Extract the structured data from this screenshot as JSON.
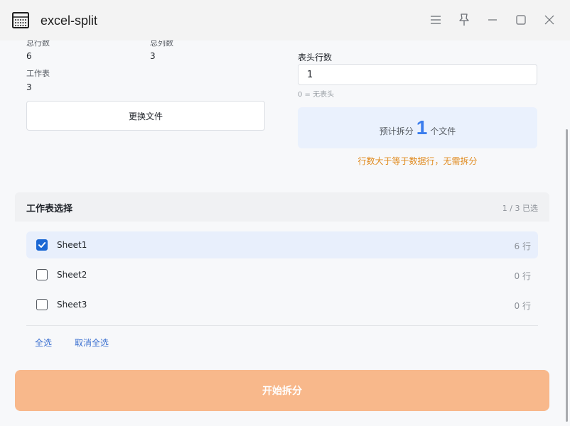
{
  "window": {
    "title": "excel-split",
    "icons": [
      "menu-icon",
      "pin-icon",
      "minimize-icon",
      "maximize-icon",
      "close-icon"
    ]
  },
  "summary": {
    "total_rows_label": "总行数",
    "total_rows_value": "6",
    "total_cols_label": "总列数",
    "total_cols_value": "3",
    "sheets_label": "工作表",
    "sheets_value": "3",
    "change_file_label": "更换文件"
  },
  "settings": {
    "header_rows_label": "表头行数",
    "header_rows_value": "1",
    "header_rows_hint": "0 = 无表头",
    "estimate_prefix": "预计拆分",
    "estimate_count": "1",
    "estimate_suffix": "个文件",
    "warning": "行数大于等于数据行，无需拆分"
  },
  "sheets": {
    "title": "工作表选择",
    "selected_summary": "1 / 3 已选",
    "items": [
      {
        "name": "Sheet1",
        "rows": "6 行",
        "checked": true
      },
      {
        "name": "Sheet2",
        "rows": "0 行",
        "checked": false
      },
      {
        "name": "Sheet3",
        "rows": "0 行",
        "checked": false
      }
    ],
    "select_all": "全选",
    "deselect_all": "取消全选"
  },
  "actions": {
    "start_label": "开始拆分"
  },
  "colors": {
    "accent": "#1a67d4",
    "estimate_number": "#3b7ded",
    "warning": "#e08a1e",
    "start_button": "#f8b88b",
    "selected_row": "#e8effc"
  }
}
